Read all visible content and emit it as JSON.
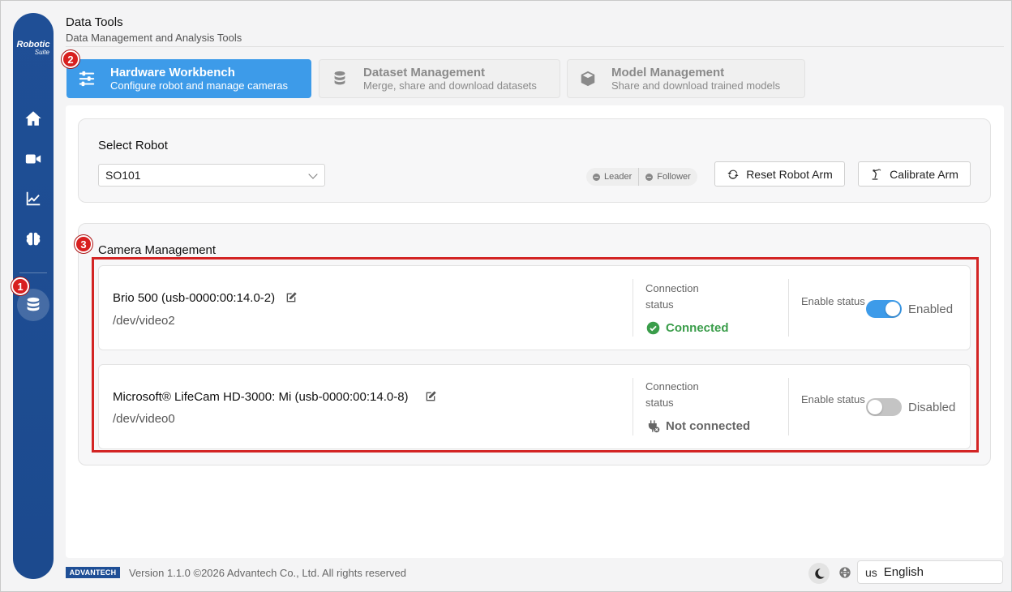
{
  "app": {
    "title": "Data Tools",
    "subtitle": "Data Management and Analysis Tools"
  },
  "sidebar": {
    "logo_main": "Robotic",
    "logo_sub": "Suite",
    "items": [
      {
        "name": "home",
        "icon": "home-icon"
      },
      {
        "name": "camera",
        "icon": "video-icon"
      },
      {
        "name": "charts",
        "icon": "chart-line-icon"
      },
      {
        "name": "ai",
        "icon": "brain-icon"
      },
      {
        "name": "data",
        "icon": "database-icon",
        "active": true
      }
    ]
  },
  "markers": {
    "m1": "1",
    "m2": "2",
    "m3": "3"
  },
  "tabs": [
    {
      "label": "Hardware Workbench",
      "desc": "Configure robot and manage cameras",
      "icon": "sliders-icon",
      "active": true
    },
    {
      "label": "Dataset Management",
      "desc": "Merge, share and download datasets",
      "icon": "database-icon",
      "active": false
    },
    {
      "label": "Model Management",
      "desc": "Share and download trained models",
      "icon": "cube-icon",
      "active": false
    }
  ],
  "robot": {
    "section_label": "Select Robot",
    "selected": "SO101",
    "leader_label": "Leader",
    "follower_label": "Follower",
    "reset_label": "Reset Robot Arm",
    "calibrate_label": "Calibrate Arm"
  },
  "cameras": {
    "section_label": "Camera Management",
    "connection_label": "Connection status",
    "enable_label": "Enable status",
    "items": [
      {
        "name": "Brio 500 (usb-0000:00:14.0-2)",
        "path": "/dev/video2",
        "status": "Connected",
        "enabled": true,
        "toggle_label": "Enabled"
      },
      {
        "name": "Microsoft® LifeCam HD-3000: Mi (usb-0000:00:14.0-8)",
        "path": "/dev/video0",
        "status": "Not connected",
        "enabled": false,
        "toggle_label": "Disabled"
      }
    ]
  },
  "footer": {
    "brand": "ADVANTECH",
    "version_text": "Version 1.1.0 ©2026 Advantech Co., Ltd. All rights reserved",
    "language_code": "us",
    "language": "English"
  },
  "colors": {
    "sidebar": "#1f4f96",
    "accent": "#3d9be9",
    "connected": "#3a9d4a",
    "not_connected": "#666666",
    "highlight": "#d32424"
  }
}
